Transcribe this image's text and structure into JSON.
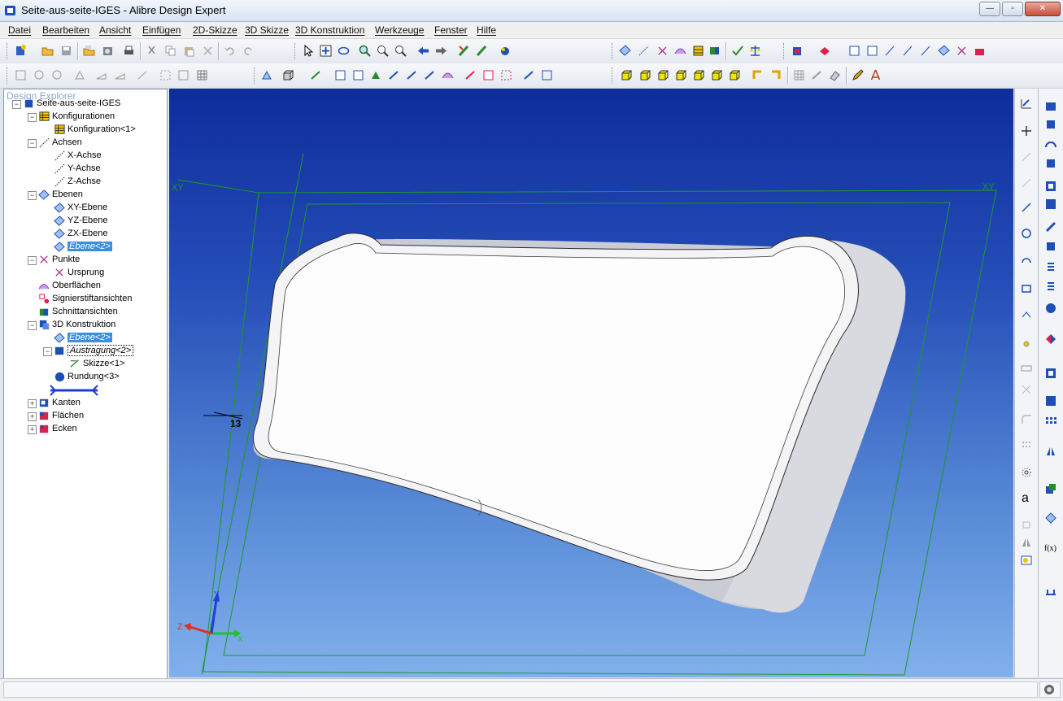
{
  "window": {
    "title": "Seite-aus-seite-IGES - Alibre Design Expert",
    "minimize_label": "—",
    "maximize_label": "▫",
    "close_label": "✕"
  },
  "menu": [
    "Datei",
    "Bearbeiten",
    "Ansicht",
    "Einfügen",
    "2D-Skizze",
    "3D Skizze",
    "3D Konstruktion",
    "Werkzeuge",
    "Fenster",
    "Hilfe"
  ],
  "explorer": {
    "header": "Design Explorer",
    "tree": [
      {
        "label": "Seite-aus-seite-IGES",
        "icon": "part-icon",
        "toggle": "−"
      },
      {
        "label": "Konfigurationen",
        "icon": "table-icon",
        "toggle": "−"
      },
      {
        "label": "Konfiguration<1>",
        "icon": "table-icon",
        "toggle": ""
      },
      {
        "label": "Achsen",
        "icon": "axis-icon",
        "toggle": "−"
      },
      {
        "label": "X-Achse",
        "icon": "axis-icon",
        "toggle": ""
      },
      {
        "label": "Y-Achse",
        "icon": "axis-icon",
        "toggle": ""
      },
      {
        "label": "Z-Achse",
        "icon": "axis-icon",
        "toggle": ""
      },
      {
        "label": "Ebenen",
        "icon": "plane-icon",
        "toggle": "−"
      },
      {
        "label": "XY-Ebene",
        "icon": "plane-icon",
        "toggle": ""
      },
      {
        "label": "YZ-Ebene",
        "icon": "plane-icon",
        "toggle": ""
      },
      {
        "label": "ZX-Ebene",
        "icon": "plane-icon",
        "toggle": ""
      },
      {
        "label": "Ebene<2>",
        "icon": "plane-icon",
        "toggle": ""
      },
      {
        "label": "Punkte",
        "icon": "point-icon",
        "toggle": "−"
      },
      {
        "label": "Ursprung",
        "icon": "point-icon",
        "toggle": ""
      },
      {
        "label": "Oberflächen",
        "icon": "surface-icon",
        "toggle": ""
      },
      {
        "label": "Signierstiftansichten",
        "icon": "pen-view-icon",
        "toggle": ""
      },
      {
        "label": "Schnittansichten",
        "icon": "section-view-icon",
        "toggle": ""
      },
      {
        "label": "3D Konstruktion",
        "icon": "feature-icon",
        "toggle": "−"
      },
      {
        "label": "Ebene<2>",
        "icon": "plane-icon",
        "toggle": ""
      },
      {
        "label": "Austragung<2>",
        "icon": "extrude-icon",
        "toggle": "−"
      },
      {
        "label": "Skizze<1>",
        "icon": "sketch-icon",
        "toggle": ""
      },
      {
        "label": "Rundung<3>",
        "icon": "fillet-icon",
        "toggle": ""
      },
      {
        "label": "",
        "icon": "rollback-bar-icon",
        "toggle": ""
      },
      {
        "label": "Kanten",
        "icon": "edges-icon",
        "toggle": "+"
      },
      {
        "label": "Flächen",
        "icon": "faces-icon",
        "toggle": "+"
      },
      {
        "label": "Ecken",
        "icon": "vertices-icon",
        "toggle": "+"
      }
    ]
  },
  "viewport": {
    "plane_label_left": "XY",
    "plane_label_right": "XY",
    "dimension_value": "13",
    "triad": {
      "x": "X",
      "y": "Y",
      "z": "Z"
    },
    "colors": {
      "plane_lines": "#1a9a2a",
      "x_axis": "#22c02a",
      "y_axis": "#1f3fe0",
      "z_axis": "#e03020",
      "body": "#f4f4f6"
    }
  },
  "statusbar": {
    "left": "",
    "right": ""
  }
}
